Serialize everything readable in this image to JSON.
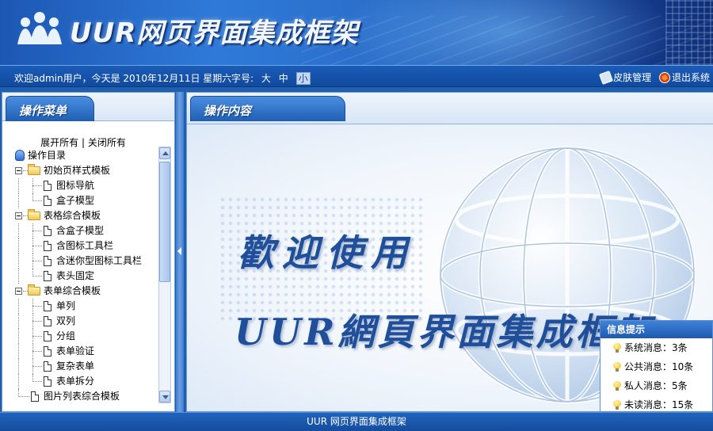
{
  "header": {
    "title": "UUR网页界面集成框架"
  },
  "statusbar": {
    "welcome_text": "欢迎admin用户，今天是 2010年12月11日 星期六",
    "font_size_label": "字号:",
    "font_sizes": [
      "大",
      "中",
      "小"
    ],
    "active_font_size": "小",
    "skin_label": "皮肤管理",
    "logout_label": "退出系统"
  },
  "left_panel": {
    "title": "操作菜单",
    "expand_all": "展开所有",
    "separator": "|",
    "collapse_all": "关闭所有",
    "root": "操作目录",
    "groups": [
      {
        "label": "初始页样式模板",
        "items": [
          "图标导航",
          "盒子模型"
        ]
      },
      {
        "label": "表格综合模板",
        "items": [
          "含盒子模型",
          "含图标工具栏",
          "含迷你型图标工具栏",
          "表头固定"
        ]
      },
      {
        "label": "表单综合模板",
        "items": [
          "单列",
          "双列",
          "分组",
          "表单验证",
          "复杂表单",
          "表单拆分"
        ]
      }
    ],
    "trailing_item": "图片列表综合模板"
  },
  "right_panel": {
    "title": "操作内容",
    "welcome_line1": "歡迎使用",
    "welcome_line2": "UUR網頁界面集成框架"
  },
  "info_popup": {
    "title": "信息提示",
    "items": [
      {
        "label": "系统消息：3条"
      },
      {
        "label": "公共消息：10条"
      },
      {
        "label": "私人消息：5条"
      },
      {
        "label": "未读消息：15条"
      }
    ]
  },
  "footer": {
    "text": "UUR 网页界面集成框架"
  },
  "colors": {
    "brand_blue": "#1f5fae",
    "heading_blue": "#1f4f9a",
    "popup_header": "#2a6cc6"
  }
}
